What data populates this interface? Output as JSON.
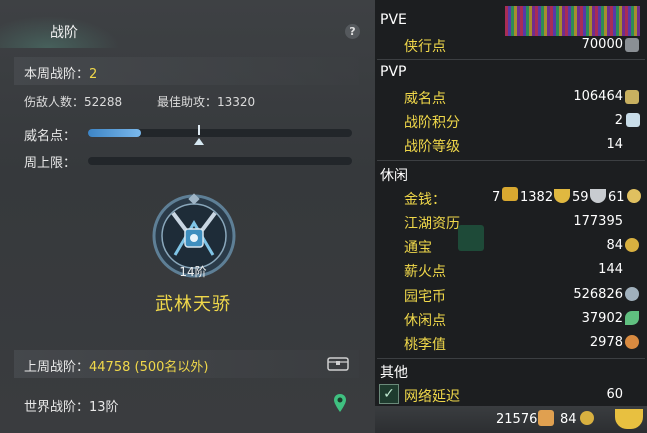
{
  "left": {
    "tab_title": "战阶",
    "help_label": "?",
    "weekly_rank_label": "本周战阶：",
    "weekly_rank_value": "2",
    "enemies_label": "伤敌人数：",
    "enemies_value": "52288",
    "best_assist_label": "最佳助攻：",
    "best_assist_value": "13320",
    "prestige_label": "威名点：",
    "prestige_progress": 0.2,
    "weekly_limit_label": "周上限：",
    "weekly_limit_progress": 0.0,
    "rank_level": "14阶",
    "rank_name": "武林天骄",
    "last_week_label": "上周战阶：",
    "last_week_value": "44758 (500名以外)",
    "world_rank_label": "世界战阶：",
    "world_rank_value": "13阶"
  },
  "right": {
    "pve": {
      "header": "PVE",
      "items": [
        {
          "label": "侠行点",
          "value": "70000",
          "icon": "sword-icon"
        }
      ]
    },
    "pvp": {
      "header": "PVP",
      "items": [
        {
          "label": "威名点",
          "value": "106464",
          "icon": "prestige-icon"
        },
        {
          "label": "战阶积分",
          "value": "2",
          "icon": "crystal-icon"
        },
        {
          "label": "战阶等级",
          "value": "14"
        }
      ]
    },
    "leisure": {
      "header": "休闲",
      "money_label": "金钱：",
      "money_gold": "7",
      "money_silver_big": "1382",
      "money_silver": "59",
      "money_copper": "61",
      "items": [
        {
          "label": "江湖资历",
          "value": "177395"
        },
        {
          "label": "通宝",
          "value": "84",
          "icon": "coin-icon"
        },
        {
          "label": "薪火点",
          "value": "144"
        },
        {
          "label": "园宅币",
          "value": "526826",
          "icon": "garden-coin-icon"
        },
        {
          "label": "休闲点",
          "value": "37902",
          "icon": "leaf-icon"
        },
        {
          "label": "桃李值",
          "value": "2978",
          "icon": "gourd-icon"
        }
      ]
    },
    "other": {
      "header": "其他",
      "items": [
        {
          "label": "网络延迟",
          "value": "60"
        }
      ]
    },
    "bottom": {
      "value1": "21576",
      "value2": "84"
    }
  },
  "colors": {
    "accent_yellow": "#f0d84a",
    "progress_blue": "#3d85c6",
    "panel_dark": "#1c1e20"
  }
}
